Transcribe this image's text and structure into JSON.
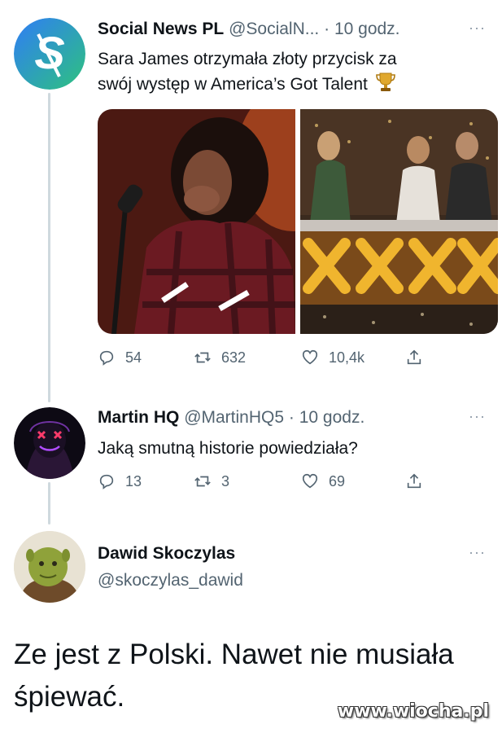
{
  "tweets": [
    {
      "name": "Social News PL",
      "handle": "@SocialN...",
      "dot": "·",
      "time": "10 godz.",
      "text_line1": "Sara James otrzymała złoty przycisk za",
      "text_line2": "swój występ w America’s Got Talent",
      "trophy_icon": "trophy-icon",
      "replies": "54",
      "retweets": "632",
      "likes": "10,4k",
      "more": "···",
      "brand_color": "#3aa0ff"
    },
    {
      "name": "Martin HQ",
      "handle": "@MartinHQ5",
      "dot": "·",
      "time": "10 godz.",
      "text": "Jaką smutną historie powiedziała?",
      "replies": "13",
      "retweets": "3",
      "likes": "69",
      "more": "···"
    },
    {
      "name": "Dawid Skoczylas",
      "handle": "@skoczylas_dawid",
      "more": "···",
      "text_line1": "Ze jest z Polski. Nawet nie musiała",
      "text_line2": "śpiewać."
    }
  ],
  "watermark": "www.wiocha.pl"
}
